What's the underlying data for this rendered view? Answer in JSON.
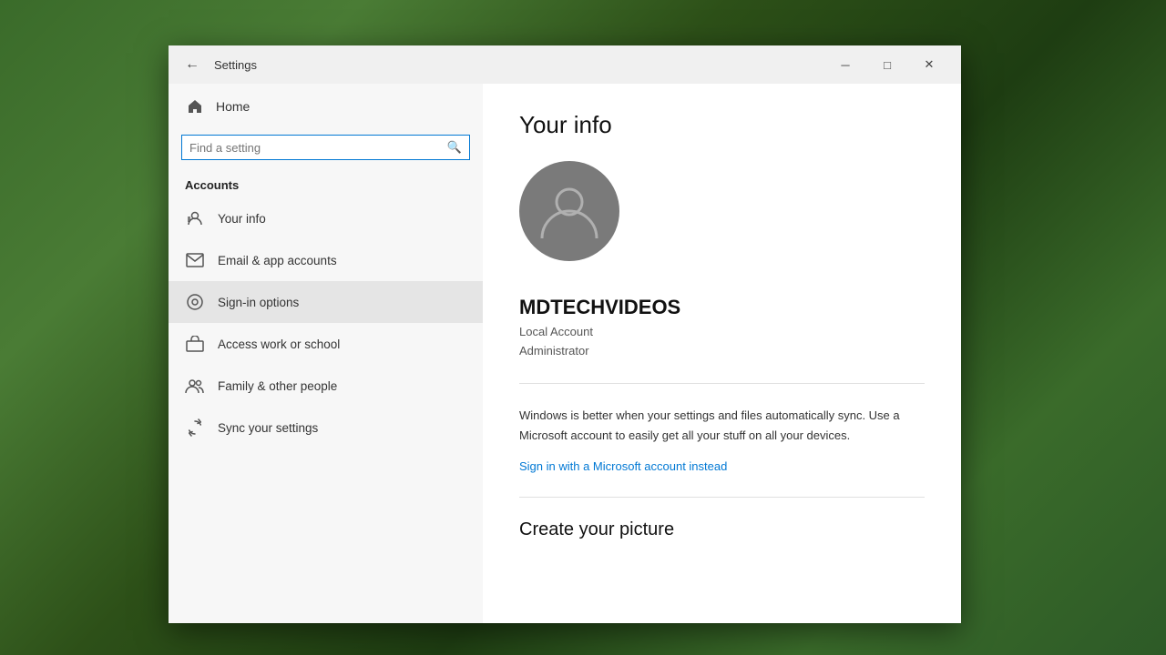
{
  "window": {
    "title": "Settings",
    "minimize_label": "─",
    "maximize_label": "□",
    "close_label": "✕"
  },
  "sidebar": {
    "home_label": "Home",
    "search_placeholder": "Find a setting",
    "section_title": "Accounts",
    "items": [
      {
        "id": "your-info",
        "label": "Your info",
        "icon": "person-lines",
        "active": false
      },
      {
        "id": "email-app",
        "label": "Email & app accounts",
        "icon": "email",
        "active": false
      },
      {
        "id": "sign-in",
        "label": "Sign-in options",
        "icon": "key",
        "active": true
      },
      {
        "id": "work-school",
        "label": "Access work or school",
        "icon": "briefcase",
        "active": false
      },
      {
        "id": "family",
        "label": "Family & other people",
        "icon": "people",
        "active": false
      },
      {
        "id": "sync",
        "label": "Sync your settings",
        "icon": "sync",
        "active": false
      }
    ]
  },
  "main": {
    "page_title": "Your info",
    "username": "MDTECHVIDEOS",
    "account_type_line1": "Local Account",
    "account_type_line2": "Administrator",
    "sync_message": "Windows is better when your settings and files automatically sync. Use a Microsoft account to easily get all your stuff on all your devices.",
    "ms_link_label": "Sign in with a Microsoft account instead",
    "create_picture_title": "Create your picture"
  }
}
